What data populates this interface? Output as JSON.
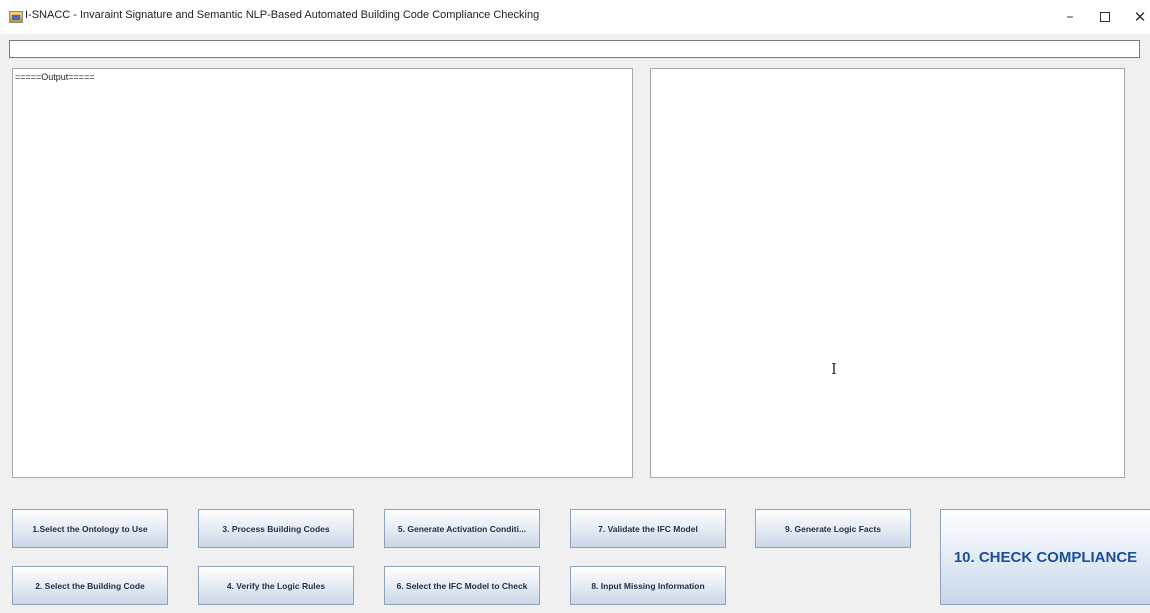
{
  "window": {
    "title": "I-SNACC - Invaraint Signature and Semantic NLP-Based Automated Building Code Compliance Checking",
    "minimize_glyph": "–",
    "close_glyph": "✕",
    "icon": "java-app-icon"
  },
  "command_input": {
    "value": ""
  },
  "output_panel": {
    "text": "=====Output====="
  },
  "right_panel": {
    "text": "",
    "cursor_icon": "text-cursor-icon"
  },
  "buttons": {
    "b1": "1.Select the Ontology to Use",
    "b2": "2. Select the Building Code",
    "b3": "3. Process Building Codes",
    "b4": "4. Verify the Logic Rules",
    "b5": "5. Generate Activation Conditi...",
    "b6": "6. Select the IFC Model to Check",
    "b7": "7. Validate the IFC Model",
    "b8": "8. Input Missing Information",
    "b9": "9. Generate Logic Facts",
    "b10": "10. CHECK COMPLIANCE"
  },
  "colors": {
    "button_text": "#1f2f45",
    "accent_text": "#1a4f9c",
    "background": "#f0f0f0"
  }
}
